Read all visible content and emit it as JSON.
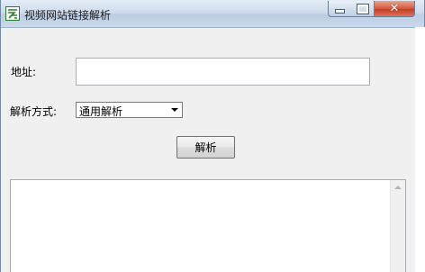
{
  "window": {
    "title": "视频网站链接解析",
    "icon": "app-logo-icon"
  },
  "titlebar_buttons": {
    "minimize": "minimize-icon",
    "maximize": "maximize-icon",
    "close": "close-icon",
    "close_glyph": "✕"
  },
  "form": {
    "address_label": "地址:",
    "address_value": "",
    "method_label": "解析方式:",
    "method_selected": "通用解析",
    "parse_button": "解析"
  },
  "output": {
    "text": ""
  },
  "colors": {
    "titlebar": "#c9d8ea",
    "window_bg": "#f0f0f0",
    "close_button": "#c33e22"
  }
}
